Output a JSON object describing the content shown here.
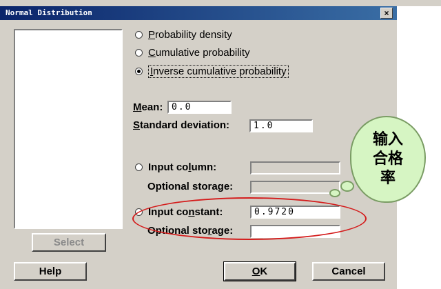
{
  "window": {
    "title": "Normal Distribution",
    "close_glyph": "×"
  },
  "options": {
    "probability_density": {
      "prefix": "",
      "u": "P",
      "rest": "robability density"
    },
    "cumulative_probability": {
      "prefix": "",
      "u": "C",
      "rest": "umulative probability"
    },
    "inverse_cumulative_probability": {
      "prefix": "",
      "u": "I",
      "rest": "nverse cumulative probability"
    }
  },
  "mean": {
    "label_u": "M",
    "label_rest": "ean:",
    "value": "0.0"
  },
  "std_dev": {
    "label_u": "S",
    "label_rest": "tandard deviation:",
    "value": "1.0"
  },
  "input_column": {
    "label_pre": "Input co",
    "label_u": "l",
    "label_post": "umn:",
    "value": ""
  },
  "optional_storage_1": {
    "label": "Optional storage:",
    "value": ""
  },
  "input_constant": {
    "label_pre": "Input co",
    "label_u": "n",
    "label_post": "stant:",
    "value": "0.9720"
  },
  "optional_storage_2": {
    "label_pre": "Optional sto",
    "label_u": "r",
    "label_post": "age:",
    "value": ""
  },
  "buttons": {
    "select": "Select",
    "help": "Help",
    "ok_u": "O",
    "ok_rest": "K",
    "cancel": "Cancel"
  },
  "annotation": {
    "line1": "输入",
    "line2": "合格",
    "line3": "率"
  },
  "colors": {
    "annotation_ellipse": "#d41c1c",
    "bubble_fill": "#d6f5c3",
    "titlebar": "#0a246a"
  }
}
